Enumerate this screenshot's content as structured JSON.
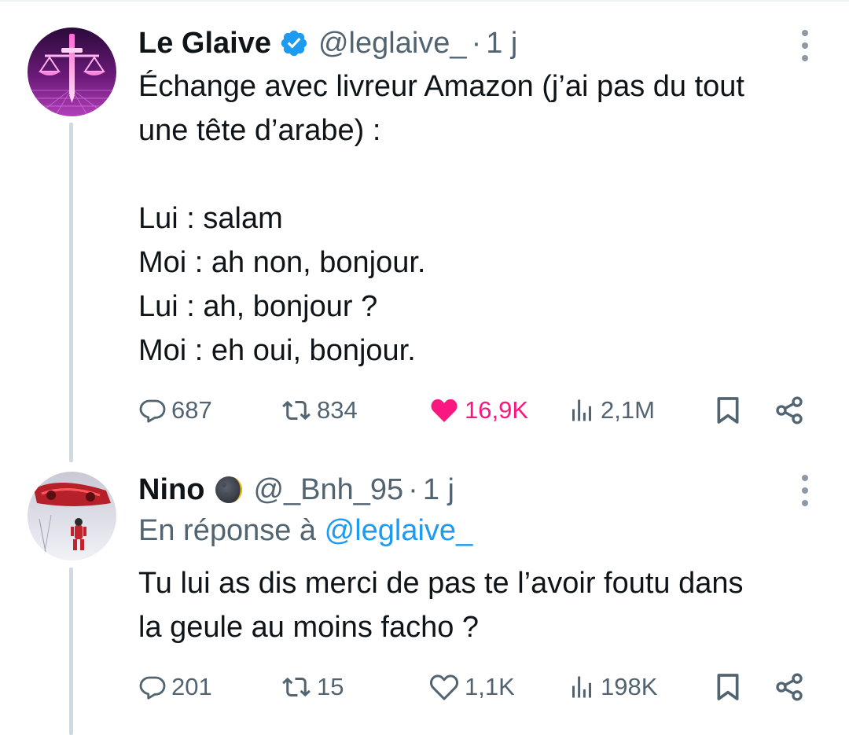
{
  "tweets": [
    {
      "author": "Le Glaive",
      "handle": "@leglaive_",
      "sep": "·",
      "time": "1 j",
      "lines": [
        "Échange avec livreur Amazon (j’ai pas du tout",
        "une tête d’arabe) :",
        "",
        "Lui : salam",
        "Moi : ah non, bonjour.",
        "Lui : ah, bonjour ?",
        "Moi : eh oui, bonjour."
      ],
      "replies": "687",
      "retweets": "834",
      "likes": "16,9K",
      "views": "2,1M",
      "liked": true
    },
    {
      "author": "Nino",
      "handle": "@_Bnh_95",
      "sep": "·",
      "time": "1 j",
      "reply_prefix": "En réponse à",
      "reply_mention": "@leglaive_",
      "lines": [
        "Tu lui as dis merci de pas te l’avoir foutu dans",
        "la geule au moins facho ?"
      ],
      "replies": "201",
      "retweets": "15",
      "likes": "1,1K",
      "views": "198K",
      "liked": false
    }
  ],
  "icons": {
    "verified": "verified-badge-icon",
    "moon": "moon-emoji-icon",
    "reply": "reply-icon",
    "retweet": "retweet-icon",
    "like": "heart-icon",
    "views": "views-icon",
    "bookmark": "bookmark-icon",
    "share": "share-icon",
    "more": "more-icon"
  },
  "colors": {
    "text": "#0f1419",
    "secondary": "#536471",
    "link": "#1d9bf0",
    "like": "#f91880",
    "thread": "#cfd9de"
  }
}
